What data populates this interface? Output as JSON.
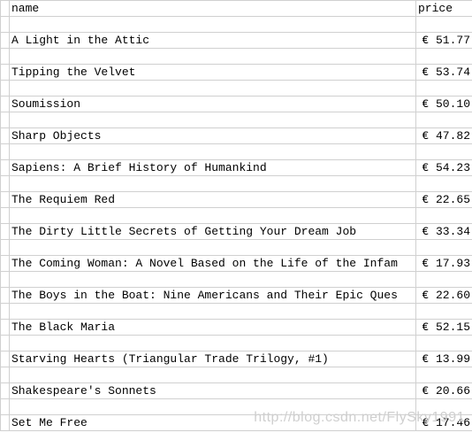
{
  "headers": {
    "name": "name",
    "price": "price"
  },
  "currency_symbol": "€",
  "rows": [
    {
      "name": "A Light in the Attic",
      "price": "€ 51.77"
    },
    {
      "name": "Tipping the Velvet",
      "price": "€ 53.74"
    },
    {
      "name": "Soumission",
      "price": "€ 50.10"
    },
    {
      "name": "Sharp Objects",
      "price": "€ 47.82"
    },
    {
      "name": "Sapiens: A Brief History of Humankind",
      "price": "€ 54.23"
    },
    {
      "name": "The Requiem Red",
      "price": "€ 22.65"
    },
    {
      "name": "The Dirty Little Secrets of Getting Your Dream Job",
      "price": "€ 33.34"
    },
    {
      "name": "The Coming Woman: A Novel Based on the Life of the Infam",
      "price": "€ 17.93"
    },
    {
      "name": "The Boys in the Boat: Nine Americans and Their Epic Ques",
      "price": "€ 22.60"
    },
    {
      "name": "The Black Maria",
      "price": "€ 52.15"
    },
    {
      "name": "Starving Hearts (Triangular Trade Trilogy, #1)",
      "price": "€ 13.99"
    },
    {
      "name": "Shakespeare's Sonnets",
      "price": "€ 20.66"
    },
    {
      "name": "Set Me Free",
      "price": "€ 17.46"
    }
  ],
  "watermark": "http://blog.csdn.net/FlySky1991"
}
